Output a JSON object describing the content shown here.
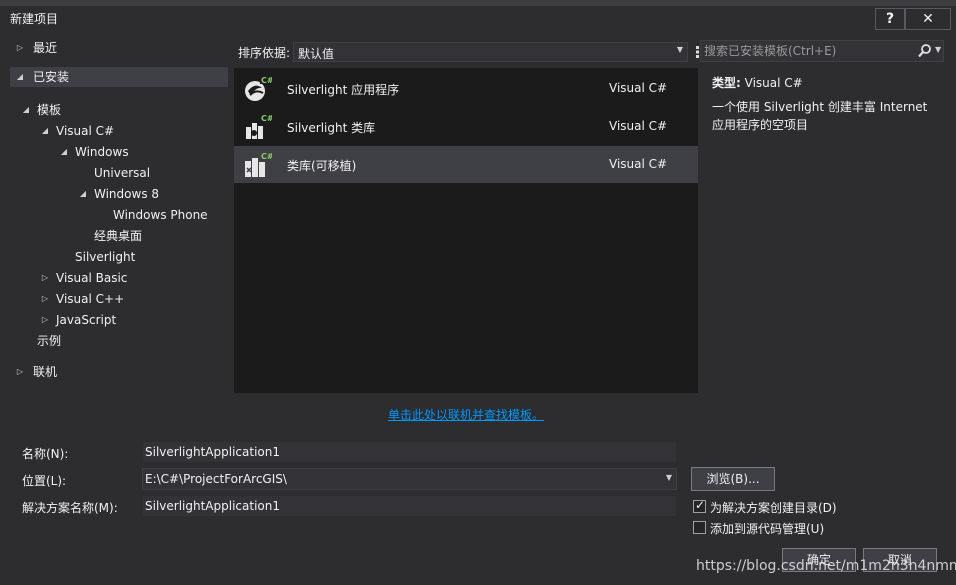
{
  "window": {
    "title": "新建项目",
    "help_glyph": "?",
    "close_glyph": "✕"
  },
  "tree": {
    "recent": "最近",
    "installed": "已安装",
    "templates": "模板",
    "visual_csharp": "Visual C#",
    "windows": "Windows",
    "universal": "Universal",
    "windows8": "Windows 8",
    "windows_phone": "Windows Phone",
    "classic_desktop": "经典桌面",
    "silverlight": "Silverlight",
    "visual_basic": "Visual Basic",
    "visual_cpp": "Visual C++",
    "javascript": "JavaScript",
    "samples": "示例",
    "online": "联机"
  },
  "toolbar": {
    "sort_label": "排序依据:",
    "sort_value": "默认值"
  },
  "templates": [
    {
      "name": "Silverlight 应用程序",
      "lang": "Visual C#"
    },
    {
      "name": "Silverlight 类库",
      "lang": "Visual C#"
    },
    {
      "name": "类库(可移植)",
      "lang": "Visual C#"
    }
  ],
  "online_link": "单击此处以联机并查找模板。",
  "search": {
    "placeholder": "搜索已安装模板(Ctrl+E)"
  },
  "details": {
    "type_label": "类型:",
    "type_value": "Visual C#",
    "description": "一个使用 Silverlight 创建丰富 Internet 应用程序的空项目"
  },
  "form": {
    "name_label": "名称(N):",
    "name_value": "SilverlightApplication1",
    "location_label": "位置(L):",
    "location_value": "E:\\C#\\ProjectForArcGIS\\",
    "solution_label": "解决方案名称(M):",
    "solution_value": "SilverlightApplication1",
    "browse_label": "浏览(B)...",
    "create_dir_label": "为解决方案创建目录(D)",
    "create_dir_checked": true,
    "add_source_label": "添加到源代码管理(U)",
    "add_source_checked": false
  },
  "buttons": {
    "ok": "确定",
    "cancel": "取消"
  },
  "watermark": "https://blog.csdn.net/m1m2n3n4nmm"
}
